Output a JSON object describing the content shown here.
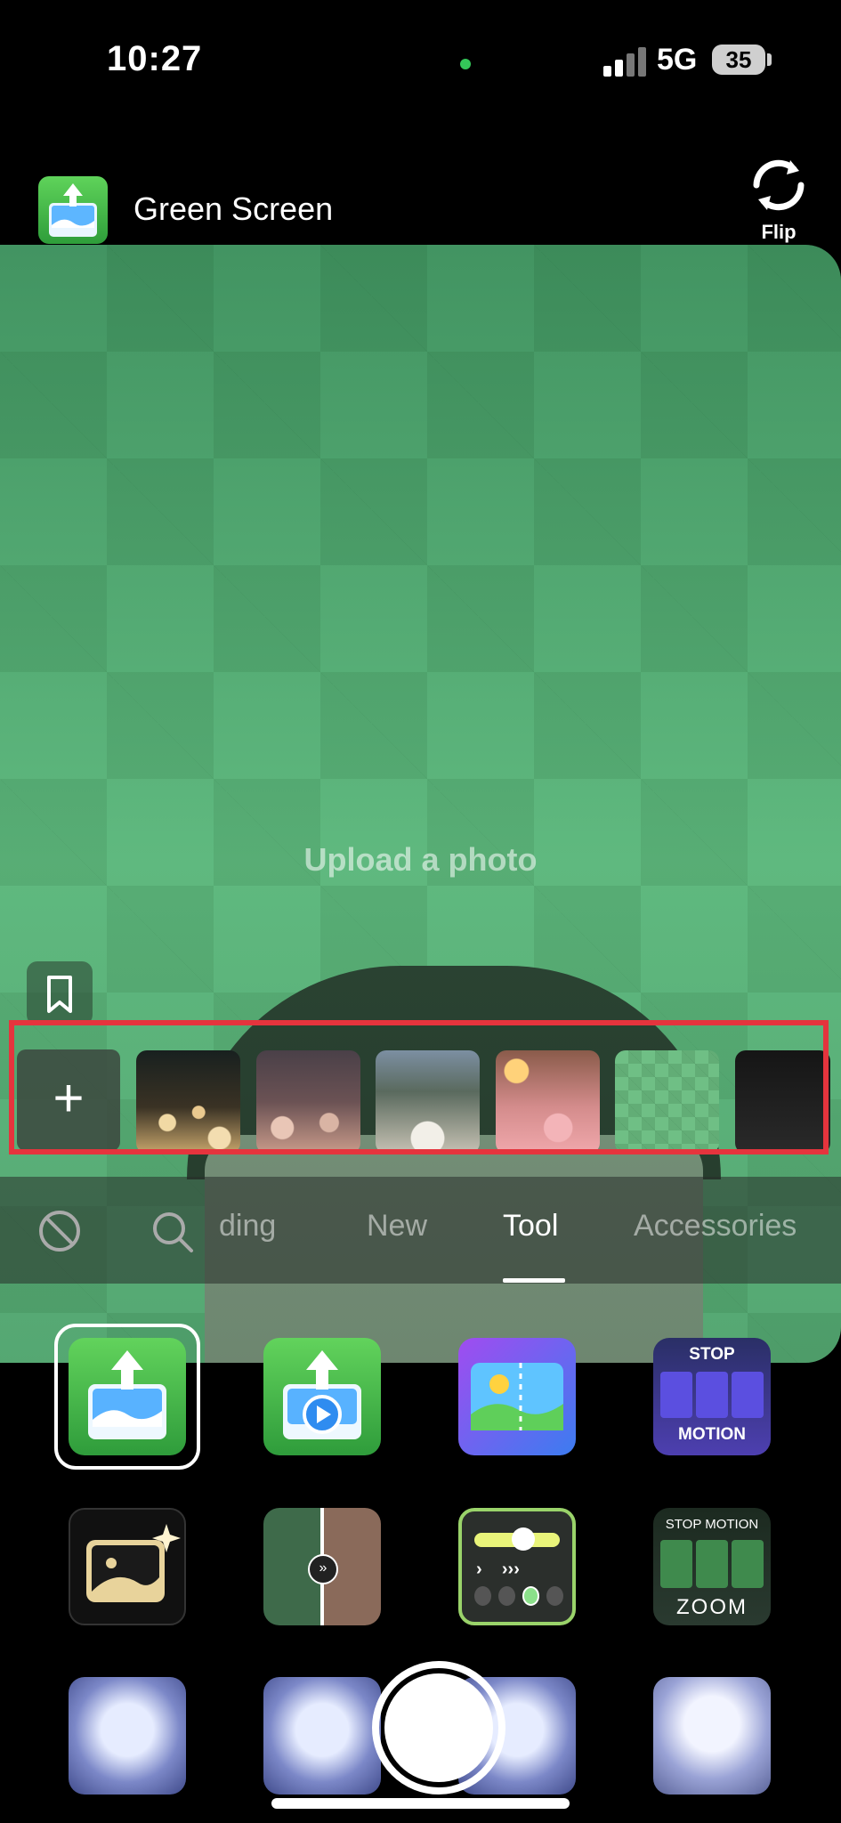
{
  "status": {
    "time": "10:27",
    "network": "5G",
    "battery": "35"
  },
  "header": {
    "effect_title": "Green Screen",
    "flip_label": "Flip"
  },
  "preview": {
    "upload_text": "Upload a photo"
  },
  "strip": {
    "add_label": "+"
  },
  "tabs": [
    {
      "label": "ding"
    },
    {
      "label": "New"
    },
    {
      "label": "Tool"
    },
    {
      "label": "Accessories"
    }
  ],
  "tiles": {
    "stop_motion": {
      "top": "STOP",
      "bottom": "MOTION"
    },
    "stop_motion_zoom": {
      "top": "STOP MOTION",
      "bottom": "ZOOM"
    }
  },
  "colors": {
    "highlight": "#e5343d",
    "green": "#3dbb46",
    "blue": "#3c7cf0"
  }
}
